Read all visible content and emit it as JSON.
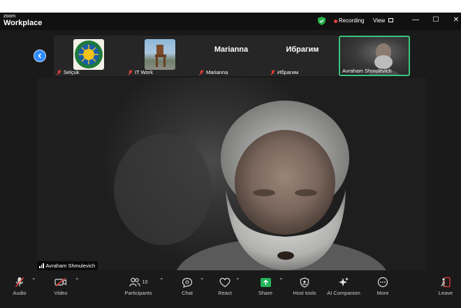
{
  "titlebar": {
    "brand_small": "zoom",
    "brand_big": "Workplace",
    "recording_label": "Recording",
    "view_label": "View",
    "minimize": "—",
    "maximize": "☐",
    "close": "✕"
  },
  "thumbnails": [
    {
      "label": "Selçuk"
    },
    {
      "label": "IT Work"
    },
    {
      "display_name": "Marianna",
      "label": "Marianna"
    },
    {
      "display_name": "Ибрагим",
      "label": "Ибрагим"
    },
    {
      "label": "Avraham Shmulevich"
    }
  ],
  "main_video": {
    "speaker_label": "Avraham Shmulevich"
  },
  "toolbar": {
    "audio": "Audio",
    "video": "Video",
    "participants": "Participants",
    "participants_count": "10",
    "chat": "Chat",
    "react": "React",
    "share": "Share",
    "host_tools": "Host tools",
    "ai_companion": "AI Companion",
    "more": "More",
    "leave": "Leave"
  },
  "colors": {
    "accent_blue": "#2d8cff",
    "recording_red": "#e5413a",
    "active_speaker_green": "#3cc47c",
    "share_green": "#24b35a",
    "muted_red": "#e5413a"
  }
}
